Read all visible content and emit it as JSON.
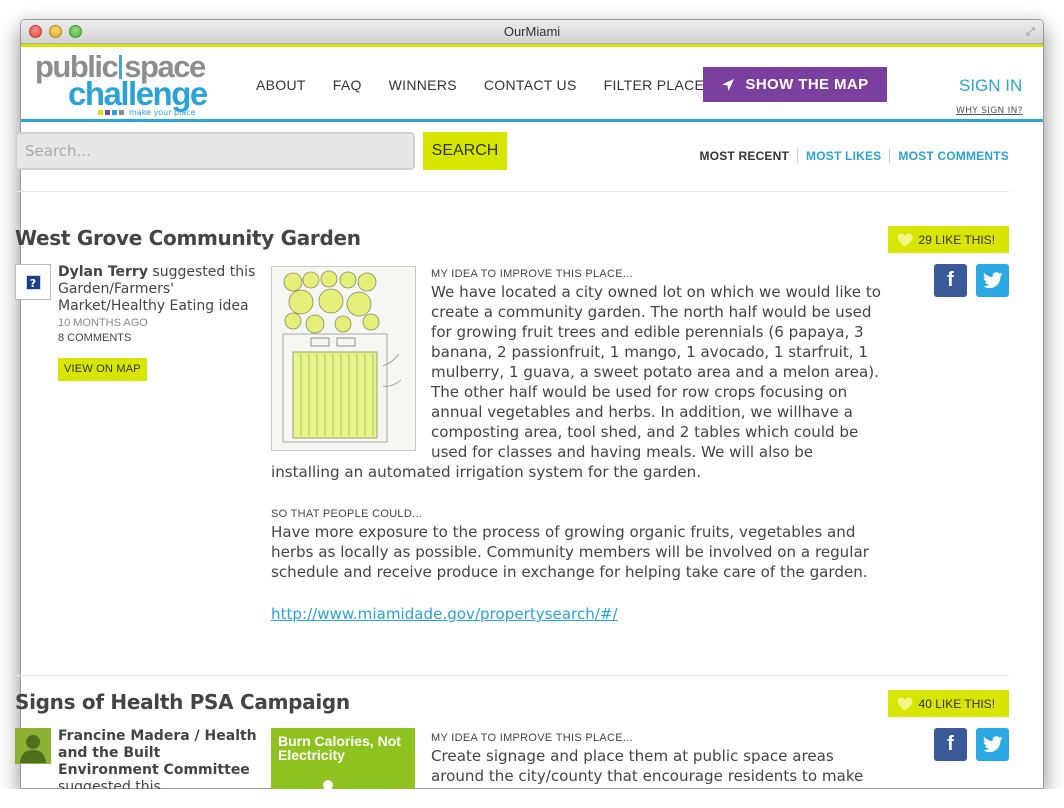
{
  "window": {
    "title": "OurMiami"
  },
  "logo": {
    "line1a": "public",
    "line1b": "space",
    "line2": "challenge",
    "tagline": "make your place"
  },
  "nav": [
    {
      "label": "ABOUT"
    },
    {
      "label": "FAQ"
    },
    {
      "label": "WINNERS"
    },
    {
      "label": "CONTACT US"
    },
    {
      "label": "FILTER PLACES"
    }
  ],
  "map_button": {
    "label": "SHOW THE MAP"
  },
  "signin": {
    "label": "SIGN IN",
    "why": "WHY SIGN IN?"
  },
  "search": {
    "placeholder": "Search...",
    "button": "SEARCH"
  },
  "sort": {
    "active": "MOST RECENT",
    "likes": "MOST LIKES",
    "comments": "MOST COMMENTS"
  },
  "colors": {
    "accent_lime": "#d6e600",
    "accent_blue": "#2aa3d6",
    "accent_purple": "#7b3fa0"
  },
  "entries": [
    {
      "title": "West Grove Community Garden",
      "likes": "29 LIKE THIS!",
      "author": "Dylan Terry",
      "suggested": " suggested this Garden/Farmers' Market/Healthy Eating idea",
      "time": "10 MONTHS AGO",
      "comments": "8 COMMENTS",
      "view_map": "VIEW ON MAP",
      "idea_label": "MY IDEA TO IMPROVE THIS PLACE...",
      "idea": "We have located a city owned lot on which we would like to create a community garden. The north half would be used for growing fruit trees and edible perennials (6 papaya, 3 banana, 2 passionfruit, 1 mango, 1 avocado, 1 starfruit, 1 mulberry, 1 guava, a sweet potato area and a melon area). The other half would be used for row crops focusing on annual vegetables and herbs. In addition, we willhave a composting area, tool shed, and 2 tables which could be used for classes and having meals. We will also be installing an automated irrigation system for the garden.",
      "people_label": "SO THAT PEOPLE COULD...",
      "people": "Have more exposure to the process of growing organic fruits, vegetables and herbs as locally as possible. Community members will be involved on a regular schedule and receive produce in exchange for helping take care of the garden.",
      "link": "http://www.miamidade.gov/propertysearch/#/"
    },
    {
      "title": "Signs of Health PSA Campaign",
      "likes": "40 LIKE THIS!",
      "author": "Francine Madera / Health and the Built Environment Committee",
      "suggested": " suggested this Signage/Wayfinding idea",
      "thumb_text": "Burn Calories, Not Electricity",
      "idea_label": "MY IDEA TO IMPROVE THIS PLACE...",
      "idea": "Create signage and place them at public space areas around the city/county that encourage residents to make"
    }
  ]
}
